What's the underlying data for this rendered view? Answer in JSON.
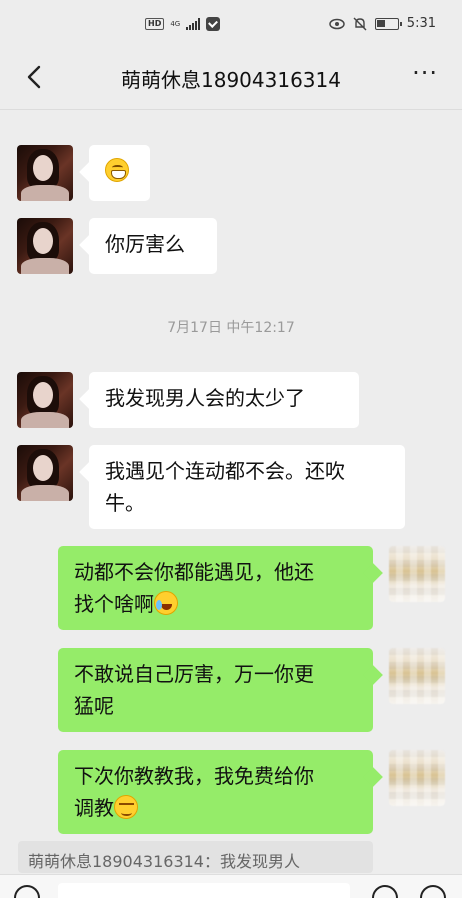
{
  "status_bar": {
    "hd": "HD",
    "network": "4G",
    "time": "5:31"
  },
  "header": {
    "title": "萌萌休息18904316314",
    "back_icon": "chevron-left-icon",
    "more_label": "···"
  },
  "messages": [
    {
      "side": "in",
      "text": "",
      "emoji": "grin-emoji"
    },
    {
      "side": "in",
      "text": "你厉害么"
    },
    {
      "type": "timestamp",
      "text": "7月17日 中午12:17"
    },
    {
      "side": "in",
      "text": "我发现男人会的太少了"
    },
    {
      "side": "in",
      "lines": [
        "我遇见个连动都不会。还吹",
        "牛。"
      ]
    },
    {
      "side": "out",
      "lines": [
        "动都不会你都能遇见，他还",
        "找个啥啊"
      ],
      "emoji": "crying-laughing-emoji"
    },
    {
      "side": "out",
      "lines": [
        "不敢说自己厉害，万一你更",
        "猛呢"
      ]
    },
    {
      "side": "out",
      "lines": [
        "下次你教教我，我免费给你",
        "调教"
      ],
      "emoji": "smirk-emoji"
    }
  ],
  "quote": {
    "text": "萌萌休息18904316314：我发现男人"
  },
  "colors": {
    "background": "#ededed",
    "incoming_bubble": "#ffffff",
    "outgoing_bubble": "#95ec69"
  }
}
